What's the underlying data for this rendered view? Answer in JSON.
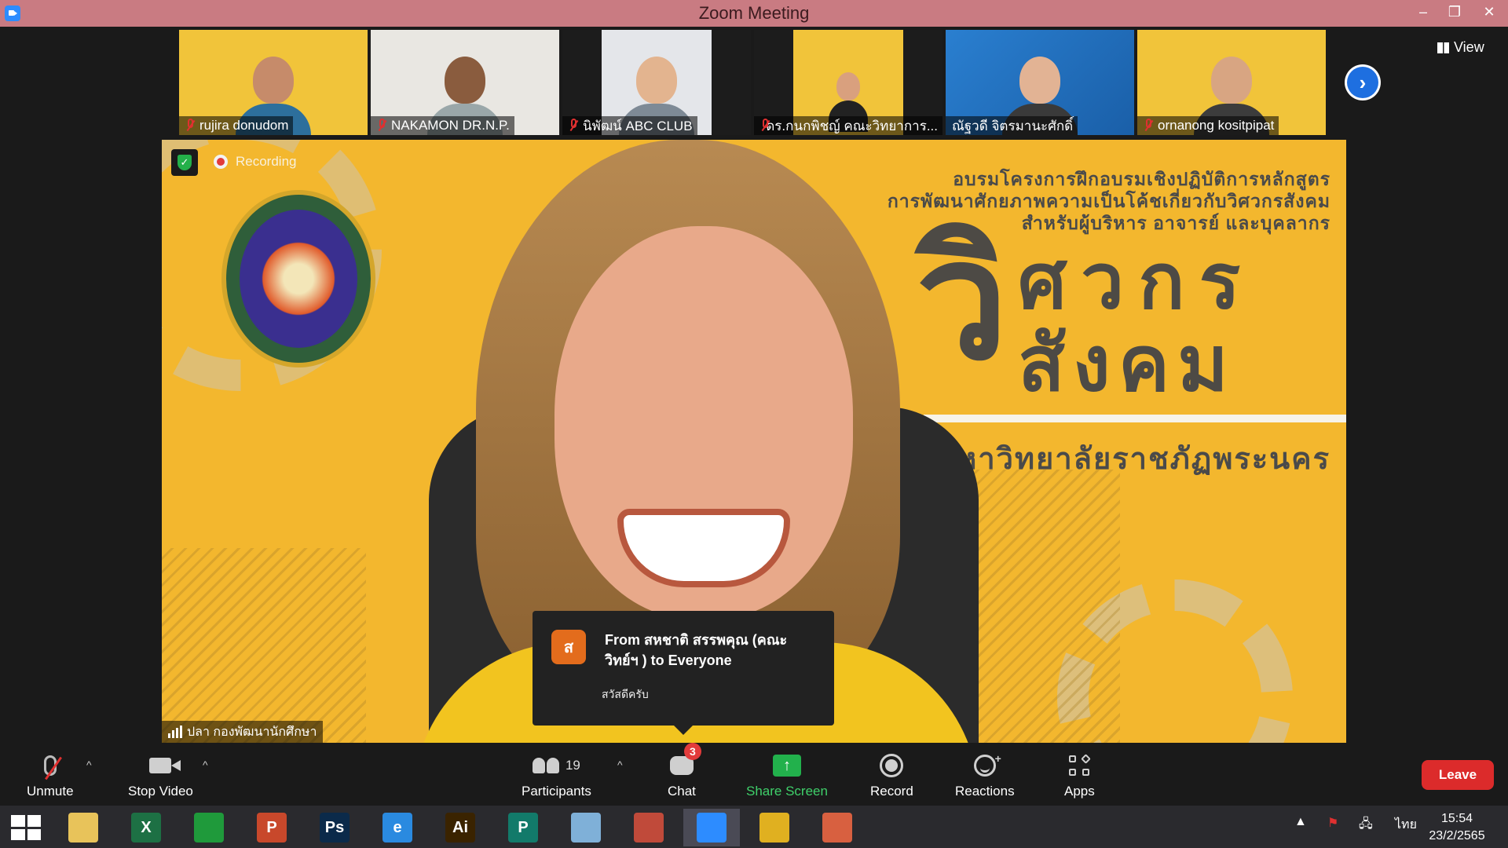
{
  "window": {
    "title": "Zoom Meeting",
    "controls": {
      "minimize": "–",
      "restore": "❐",
      "close": "✕"
    }
  },
  "thumbnails": [
    {
      "name": "rujira donudom",
      "muted": true
    },
    {
      "name": "NAKAMON DR.N.P.",
      "muted": true
    },
    {
      "name": "นิพัฒน์ ABC CLUB",
      "muted": true
    },
    {
      "name": "ดร.กนกพิชญ์ คณะวิทยาการ...",
      "muted": true
    },
    {
      "name": "ณัฐวดี จิตรมานะศักดิ์",
      "muted": false
    },
    {
      "name": "ornanong kositpipat",
      "muted": true
    }
  ],
  "view_button": {
    "label": "View"
  },
  "next_button": {
    "glyph": "›"
  },
  "main_video": {
    "recording_label": "Recording",
    "shield_glyph": "✓",
    "banner_lines": [
      "อบรมโครงการฝึกอบรมเชิงปฏิบัติการหลักสูตร",
      "การพัฒนาศักยภาพความเป็นโค้ชเกี่ยวกับวิศวกรสังคม",
      "สำหรับผู้บริหาร อาจารย์ และบุคลากร"
    ],
    "big_title": {
      "vi": "วิ",
      "line1": "ศวกร",
      "line2": "สังคม"
    },
    "university": "มหาวิทยาลัยราชภัฏพระนคร",
    "speaker_name": "ปลา กองพัฒนานักศึกษา"
  },
  "chat_toast": {
    "avatar_letter": "ส",
    "from": "From สหชาติ สรรพคุณ (คณะ วิทย์ฯ ) to Everyone",
    "message": "สวัสดีครับ"
  },
  "toolbar": {
    "unmute": "Unmute",
    "stop_video": "Stop Video",
    "participants": "Participants",
    "participants_count": "19",
    "chat": "Chat",
    "chat_badge": "3",
    "share_screen": "Share Screen",
    "share_glyph": "↑",
    "record": "Record",
    "reactions": "Reactions",
    "apps": "Apps",
    "leave": "Leave",
    "caret": "^"
  },
  "taskbar": {
    "apps": [
      {
        "name": "file-explorer",
        "label": "",
        "color": "#e8c35a"
      },
      {
        "name": "excel",
        "label": "X",
        "color": "#1d7044"
      },
      {
        "name": "store",
        "label": "",
        "color": "#1f9a3b"
      },
      {
        "name": "powerpoint",
        "label": "P",
        "color": "#c8482b"
      },
      {
        "name": "photoshop",
        "label": "Ps",
        "color": "#0b2a4a"
      },
      {
        "name": "internet-explorer",
        "label": "e",
        "color": "#2a8ae0"
      },
      {
        "name": "illustrator",
        "label": "Ai",
        "color": "#3a2300"
      },
      {
        "name": "publisher",
        "label": "P",
        "color": "#127a6a"
      },
      {
        "name": "notes",
        "label": "",
        "color": "#7fb0d8"
      },
      {
        "name": "photoscape",
        "label": "",
        "color": "#c04a3a"
      },
      {
        "name": "zoom",
        "label": "",
        "color": "#2d8cff"
      },
      {
        "name": "chrome",
        "label": "",
        "color": "#e0b020"
      },
      {
        "name": "photos",
        "label": "",
        "color": "#d86040"
      }
    ],
    "language": "ไทย",
    "time": "15:54",
    "date": "23/2/2565",
    "tray_up": "▲"
  },
  "colors": {
    "titlebar": "#c97b82",
    "slide_background": "#f3b72e",
    "share_green": "#22b14c",
    "leave_red": "#dc2b2b",
    "zoom_blue": "#2d8cff"
  }
}
